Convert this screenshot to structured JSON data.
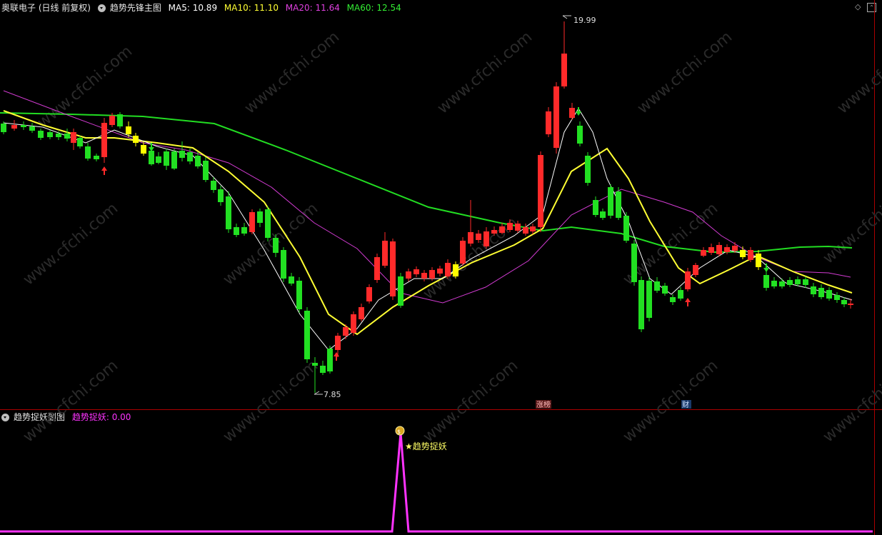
{
  "main_header": {
    "stock": "奥联电子 (日线 前复权)",
    "indicator": "趋势先锋主图",
    "ma5": "MA5: 10.89",
    "ma10": "MA10: 11.10",
    "ma20": "MA20: 11.64",
    "ma60": "MA60: 12.54"
  },
  "sub_header": {
    "indicator": "趋势捉妖副图",
    "value": "趋势捉妖: 0.00"
  },
  "annotations": {
    "high_label": "19.99",
    "low_label": "7.85",
    "event_zhangting": "涨榜",
    "event_cai": "财",
    "signal_label": "★趋势捉妖"
  },
  "watermark": "www.cfchi.com",
  "colors": {
    "up": "#ff2a2a",
    "down": "#22e022",
    "flat": "#ffff00",
    "ma5": "#ffffff",
    "ma10": "#ffff33",
    "ma20": "#d13bd1",
    "ma60": "#22dd22",
    "signal": "#ff33ff"
  },
  "chart_data": {
    "type": "candlestick",
    "price_range": [
      7.85,
      19.99
    ],
    "high": 19.99,
    "low": 7.85,
    "ma_latest": {
      "MA5": 10.89,
      "MA10": 11.1,
      "MA20": 11.64,
      "MA60": 12.54
    },
    "sub_indicator_latest": 0.0
  }
}
